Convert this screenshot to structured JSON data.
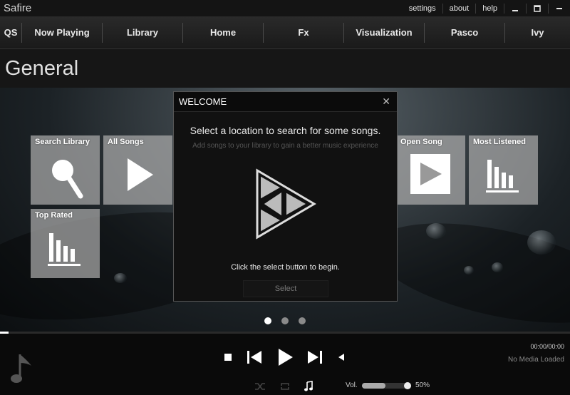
{
  "app": {
    "title": "Safire"
  },
  "window_links": [
    "settings",
    "about",
    "help"
  ],
  "nav": {
    "items": [
      {
        "label": "QS"
      },
      {
        "label": "Now Playing"
      },
      {
        "label": "Library"
      },
      {
        "label": "Home"
      },
      {
        "label": "Fx"
      },
      {
        "label": "Visualization"
      },
      {
        "label": "Pasco"
      },
      {
        "label": "Ivy"
      }
    ]
  },
  "page": {
    "title": "General"
  },
  "tiles": [
    {
      "label": "Search Library",
      "icon": "search-icon"
    },
    {
      "label": "All Songs",
      "icon": "play-triangle-icon"
    },
    {
      "label": "Open Song",
      "icon": "play-box-icon"
    },
    {
      "label": "Most Listened",
      "icon": "bar-chart-icon"
    },
    {
      "label": "Top Rated",
      "icon": "bar-chart-icon"
    }
  ],
  "pager": {
    "count": 3,
    "active": 0
  },
  "modal": {
    "title": "WELCOME",
    "close": "✕",
    "heading": "Select a location to search for some songs.",
    "subheading": "Add songs to your library to gain a better music experience",
    "hint": "Click the select button to begin.",
    "select_label": "Select"
  },
  "player": {
    "progress_fraction": 0.015,
    "time": "00:00/00:00",
    "media_status": "No Media Loaded",
    "volume_label": "Vol.",
    "volume_percent": "50%",
    "volume_fraction": 0.5
  },
  "colors": {
    "accent": "#ffffff",
    "tile": "#aaaaaa",
    "background": "#000000"
  }
}
